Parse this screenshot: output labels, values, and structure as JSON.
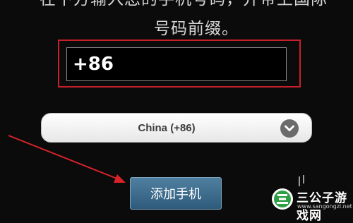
{
  "instruction": {
    "line1": "在下方输入您的手机号码，并带上国际",
    "line2": "号码前缀。"
  },
  "phone_input": {
    "value": "+86"
  },
  "country_select": {
    "selected": "China (+86)"
  },
  "add_phone_button": {
    "label": "添加手机"
  },
  "watermark": {
    "title": "三公子游戏网",
    "url": "www.sangongzi.net"
  },
  "colors": {
    "highlight": "#c8202a",
    "arrow": "#d8232a",
    "button": "#3b6a8b"
  },
  "icons": {
    "dropdown": "chevron-down-icon",
    "arrow": "arrow-annotation-icon"
  }
}
